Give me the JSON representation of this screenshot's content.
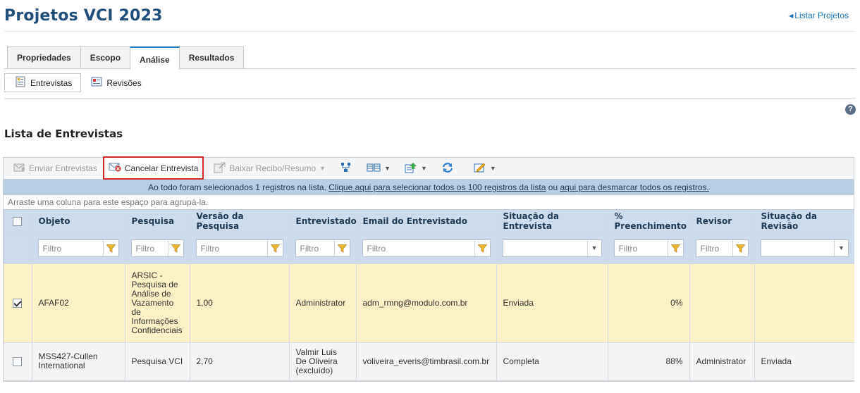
{
  "page": {
    "title": "Projetos VCI 2023",
    "back_link": "Listar Projetos"
  },
  "tabs": [
    {
      "label": "Propriedades",
      "active": false
    },
    {
      "label": "Escopo",
      "active": false
    },
    {
      "label": "Análise",
      "active": true
    },
    {
      "label": "Resultados",
      "active": false
    }
  ],
  "subtabs": [
    {
      "label": "Entrevistas",
      "icon": "interview-icon",
      "active": true
    },
    {
      "label": "Revisões",
      "icon": "review-icon",
      "active": false
    }
  ],
  "section": {
    "title": "Lista de Entrevistas"
  },
  "toolbar": {
    "send_label": "Enviar Entrevistas",
    "cancel_label": "Cancelar Entrevista",
    "download_label": "Baixar Recibo/Resumo"
  },
  "selection": {
    "prefix": "Ao todo foram selecionados 1 registros na lista. ",
    "select_all_link": "Clique aqui para selecionar todos os 100 registros da lista",
    "middle": " ou ",
    "deselect_link": "aqui para desmarcar todos os registros."
  },
  "group_hint": "Arraste uma coluna para este espaço para agrupá-la.",
  "columns": {
    "objeto": "Objeto",
    "pesquisa": "Pesquisa",
    "versao": "Versão da Pesquisa",
    "entrevistado": "Entrevistado",
    "email": "Email do Entrevistado",
    "situacao": "Situação da Entrevista",
    "preenchimento": "% Preenchimento",
    "revisor": "Revisor",
    "situacao_revisao": "Situação da Revisão"
  },
  "filter_placeholder": "Filtro",
  "rows": [
    {
      "checked": true,
      "objeto": "AFAF02",
      "pesquisa": "ARSIC - Pesquisa de Análise de Vazamento de Informações Confidenciais",
      "versao": "1,00",
      "entrevistado": "Administrator",
      "email": "adm_rmng@modulo.com.br",
      "situacao": "Enviada",
      "preenchimento": "0%",
      "revisor": "",
      "situacao_revisao": ""
    },
    {
      "checked": false,
      "objeto": "MSS427-Cullen International",
      "pesquisa": "Pesquisa VCI",
      "versao": "2,70",
      "entrevistado": "Valmir Luis De Oliveira (excluído)",
      "email": "voliveira_everis@timbrasil.com.br",
      "situacao": "Completa",
      "preenchimento": "88%",
      "revisor": "Administrator",
      "situacao_revisao": "Enviada"
    }
  ],
  "colors": {
    "title": "#1f4e79",
    "link": "#1a73b8",
    "header_bg": "#ccdced",
    "selected_row": "#fcf1c6",
    "highlight_border": "#d42a2a"
  }
}
